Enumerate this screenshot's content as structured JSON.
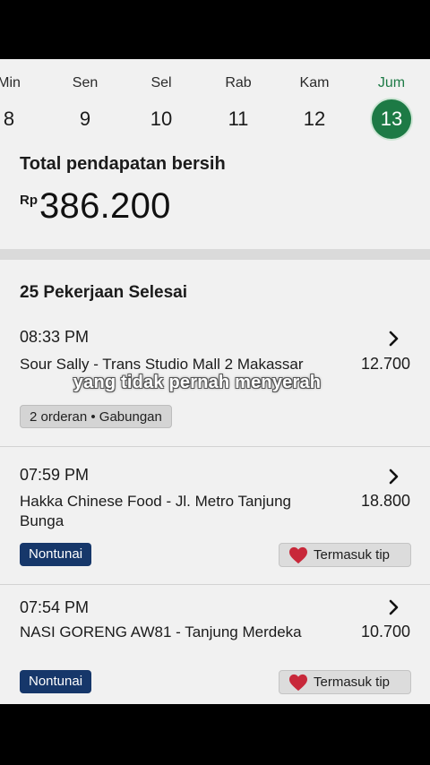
{
  "calendar": {
    "days": [
      {
        "name": "Min",
        "num": "8"
      },
      {
        "name": "Sen",
        "num": "9"
      },
      {
        "name": "Sel",
        "num": "10"
      },
      {
        "name": "Rab",
        "num": "11"
      },
      {
        "name": "Kam",
        "num": "12"
      },
      {
        "name": "Jum",
        "num": "13",
        "selected": true
      }
    ]
  },
  "earnings": {
    "label": "Total pendapatan bersih",
    "currency": "Rp",
    "amount": "386.200"
  },
  "jobs": {
    "heading": "25 Pekerjaan Selesai",
    "items": [
      {
        "time": "08:33 PM",
        "name": "Sour Sally - Trans Studio Mall 2 Makassar",
        "amount": "12.700",
        "tag": "2 orderan • Gabungan"
      },
      {
        "time": "07:59 PM",
        "name": "Hakka Chinese Food - Jl. Metro Tanjung Bunga",
        "amount": "18.800",
        "tag": "Nontunai",
        "tip": "Termasuk tip"
      },
      {
        "time": "07:54 PM",
        "name": "NASI GORENG AW81 - Tanjung Merdeka",
        "amount": "10.700",
        "tag": "Nontunai",
        "tip": "Termasuk tip"
      }
    ]
  },
  "caption": "yang tidak pernah menyerah",
  "colors": {
    "accent_green": "#1d7a45",
    "cashless_blue": "#16376a",
    "heart_red": "#c8283a"
  }
}
